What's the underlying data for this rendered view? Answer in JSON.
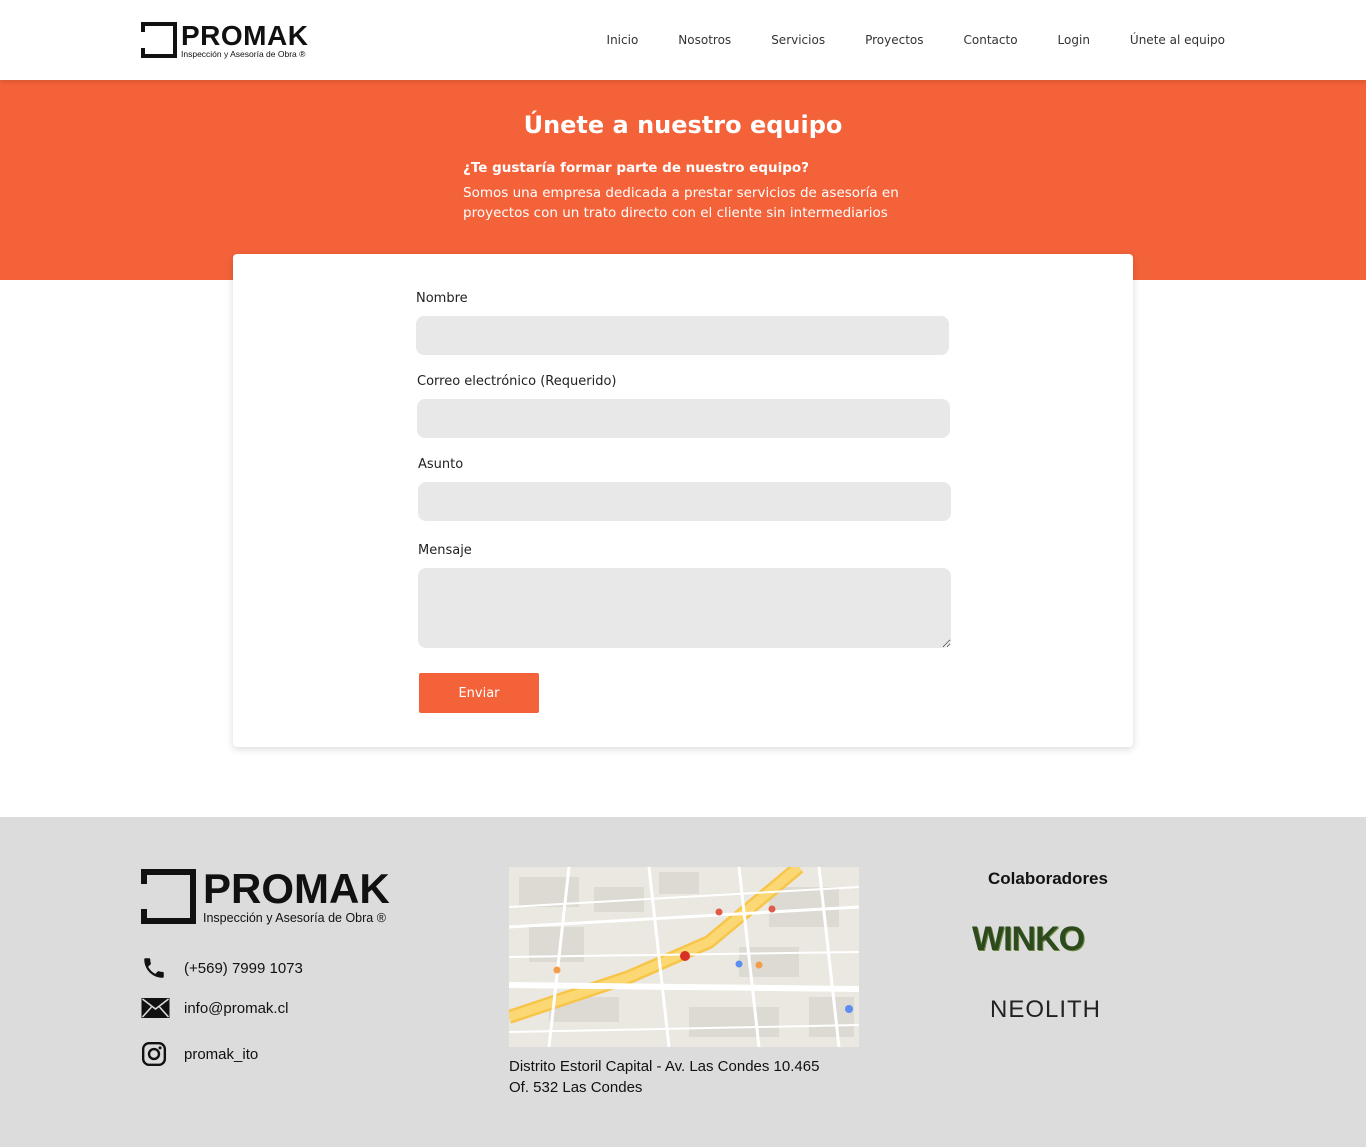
{
  "brand": {
    "name": "PROMAK",
    "tagline": "Inspección y Asesoría de Obra ®"
  },
  "nav": [
    "Inicio",
    "Nosotros",
    "Servicios",
    "Proyectos",
    "Contacto",
    "Login",
    "Únete al equipo"
  ],
  "hero": {
    "title": "Únete a nuestro equipo",
    "question": "¿Te gustaría formar parte de nuestro equipo?",
    "description": "Somos una empresa dedicada a prestar servicios de asesoría en proyectos con un trato directo con el cliente sin intermediarios"
  },
  "form": {
    "name_label": "Nombre",
    "email_label": "Correo electrónico (Requerido)",
    "subject_label": "Asunto",
    "message_label": "Mensaje",
    "submit_label": "Enviar"
  },
  "footer": {
    "phone": "(+569) 7999 1073",
    "email": "info@promak.cl",
    "instagram": "promak_ito",
    "address_line1": "Distrito Estoril Capital - Av. Las Condes 10.465",
    "address_line2": "Of. 532 Las Condes",
    "collaborators_title": "Colaboradores",
    "collaborators": [
      "WINKO",
      "NEOLITH"
    ]
  },
  "colors": {
    "accent": "#f4623a",
    "footer_bg": "#dcdcdc",
    "input_bg": "#e8e8e8"
  }
}
